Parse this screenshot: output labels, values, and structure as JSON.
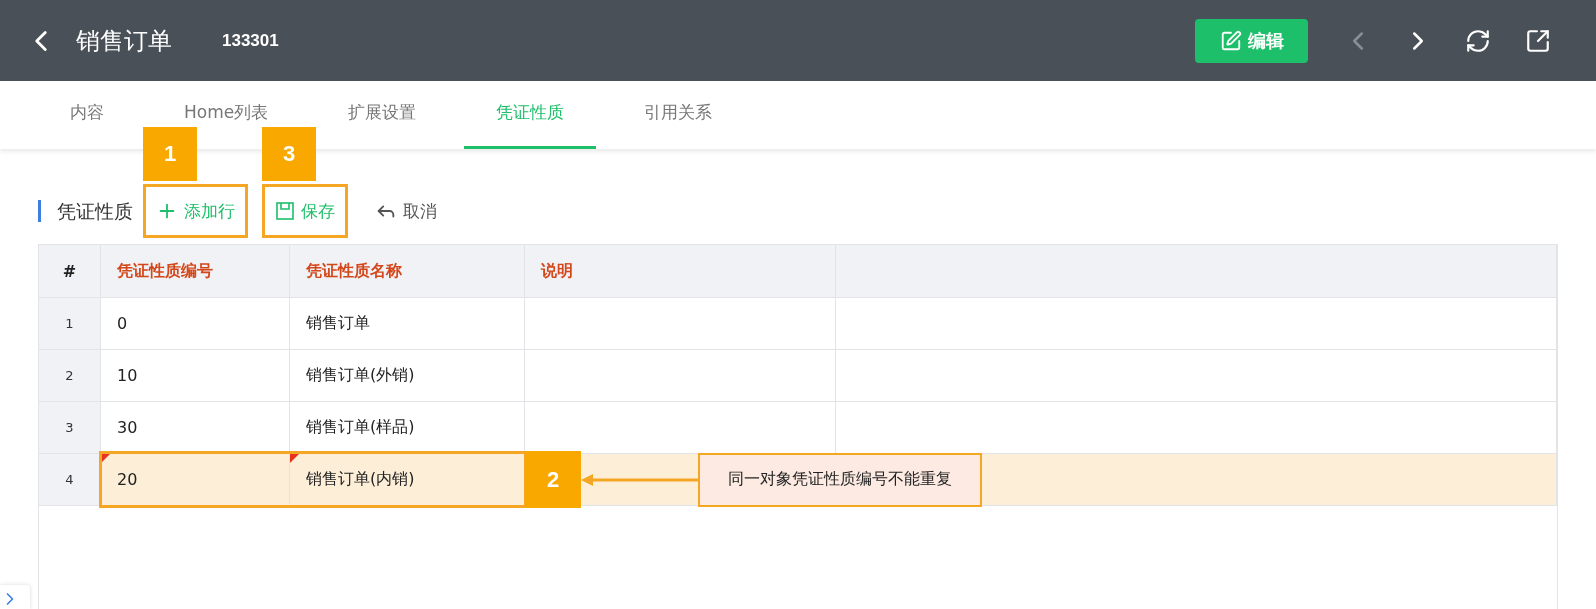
{
  "header": {
    "title": "销售订单",
    "record_id": "133301",
    "edit_button": "编辑",
    "prev_disabled": true,
    "next_disabled": false
  },
  "tabs": [
    {
      "label": "内容",
      "selected": false
    },
    {
      "label": "Home列表",
      "selected": false
    },
    {
      "label": "扩展设置",
      "selected": false
    },
    {
      "label": "凭证性质",
      "selected": true
    },
    {
      "label": "引用关系",
      "selected": false
    }
  ],
  "section": {
    "title": "凭证性质",
    "actions": [
      {
        "kind": "add",
        "label": "添加行",
        "annotation": "1"
      },
      {
        "kind": "save",
        "label": "保存",
        "annotation": "3"
      },
      {
        "kind": "cancel",
        "label": "取消"
      }
    ]
  },
  "table": {
    "columns": [
      {
        "label": "#",
        "kind": "index"
      },
      {
        "label": "凭证性质编号",
        "kind": "field"
      },
      {
        "label": "凭证性质名称",
        "kind": "field"
      },
      {
        "label": "说明",
        "kind": "field"
      }
    ],
    "rows": [
      {
        "cells": [
          "1",
          "0",
          "销售订单",
          ""
        ],
        "error": false
      },
      {
        "cells": [
          "2",
          "10",
          "销售订单(外销)",
          ""
        ],
        "error": false
      },
      {
        "cells": [
          "3",
          "30",
          "销售订单(样品)",
          ""
        ],
        "error": false
      },
      {
        "cells": [
          "4",
          "20",
          "销售订单(内销)",
          ""
        ],
        "error": true,
        "annotation": "2",
        "callout": "同一对象凭证性质编号不能重复"
      }
    ]
  }
}
